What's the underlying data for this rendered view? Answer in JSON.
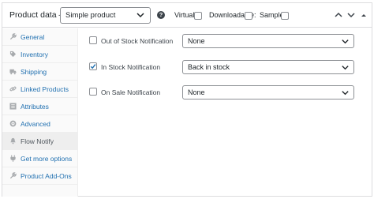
{
  "header": {
    "title": "Product data —",
    "product_type": "Simple product",
    "virtual_label": "Virtual:",
    "downloadable_label": "Downloadable:",
    "sample_label": "Sample:",
    "help_glyph": "?"
  },
  "sidebar": {
    "items": [
      {
        "label": "General",
        "icon": "wrench-icon"
      },
      {
        "label": "Inventory",
        "icon": "tag-icon"
      },
      {
        "label": "Shipping",
        "icon": "truck-icon"
      },
      {
        "label": "Linked Products",
        "icon": "link-icon"
      },
      {
        "label": "Attributes",
        "icon": "list-icon"
      },
      {
        "label": "Advanced",
        "icon": "gear-icon"
      },
      {
        "label": "Flow Notify",
        "icon": "bell-icon",
        "active": true
      },
      {
        "label": "Get more options",
        "icon": "plugin-icon"
      },
      {
        "label": "Product Add-Ons",
        "icon": "wrench-icon"
      }
    ]
  },
  "notifications": [
    {
      "label": "Out of Stock Notification",
      "checked": false,
      "value": "None"
    },
    {
      "label": "In Stock Notification",
      "checked": true,
      "value": "Back in stock"
    },
    {
      "label": "On Sale Notification",
      "checked": false,
      "value": "None"
    }
  ],
  "colors": {
    "link": "#2271b1",
    "border": "#dcdcde",
    "active_tab": "#eeeeee"
  }
}
